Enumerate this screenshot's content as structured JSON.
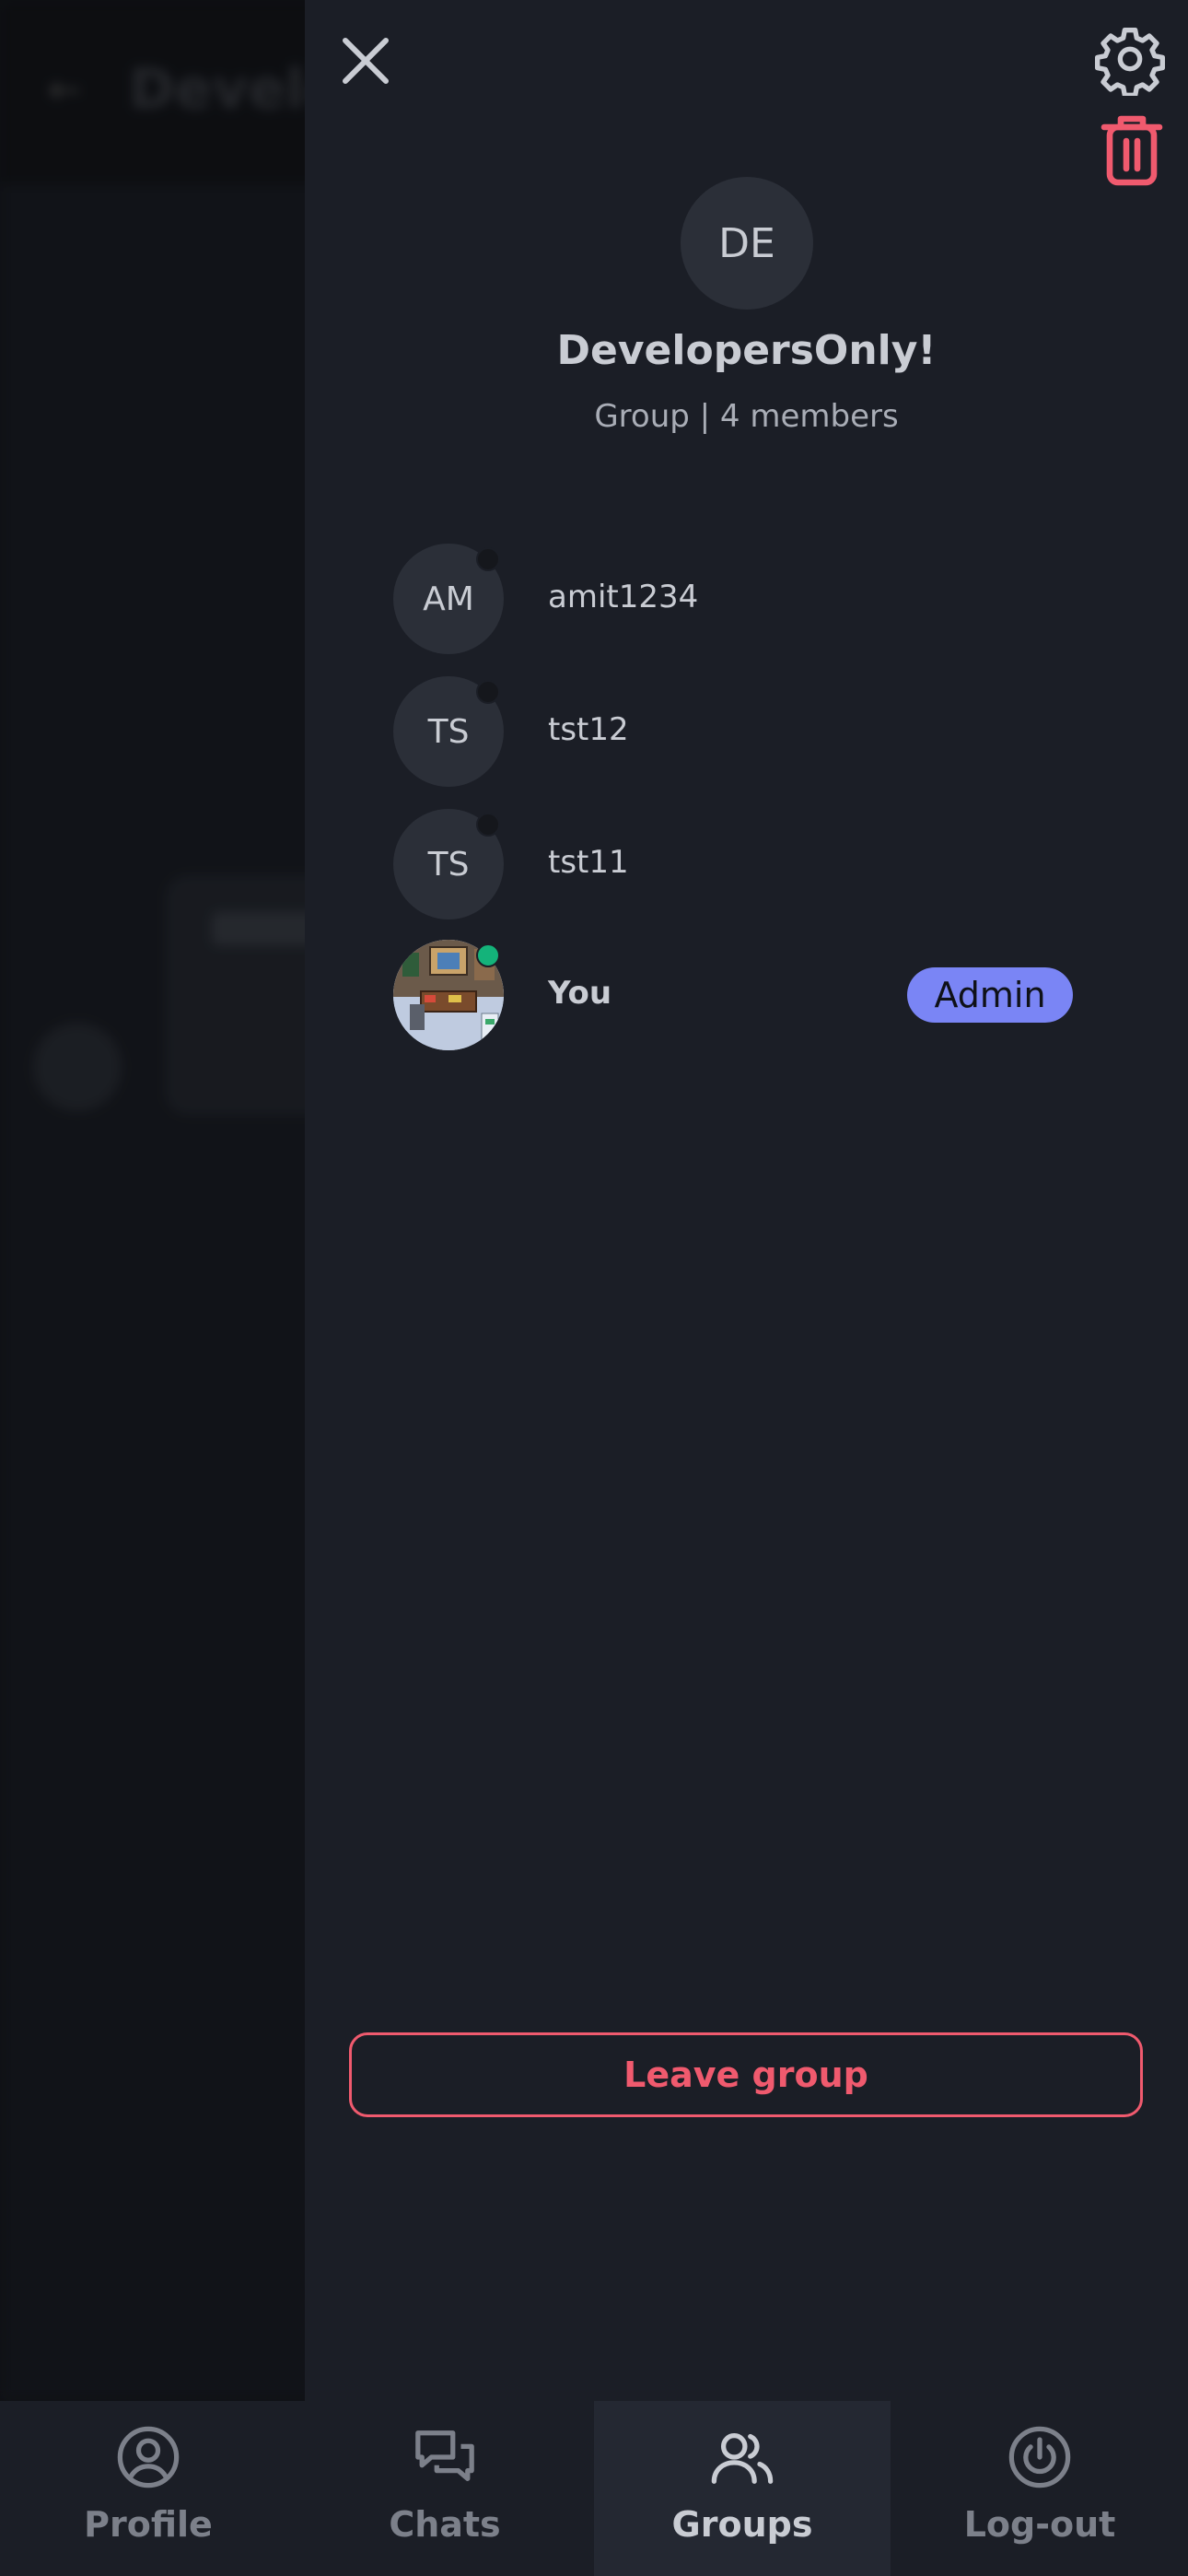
{
  "background": {
    "title": "Develo"
  },
  "drawer": {
    "group": {
      "initials": "DE",
      "name": "DevelopersOnly!",
      "subtitle": "Group | 4 members"
    },
    "members": [
      {
        "initials": "AM",
        "name": "amit1234",
        "status": "offline"
      },
      {
        "initials": "TS",
        "name": "tst12",
        "status": "offline"
      },
      {
        "initials": "TS",
        "name": "tst11",
        "status": "offline"
      },
      {
        "initials": "",
        "name": "You",
        "status": "online",
        "badge": "Admin"
      }
    ],
    "leave_label": "Leave group"
  },
  "nav": {
    "items": [
      {
        "label": "Profile",
        "icon": "user-circle-icon"
      },
      {
        "label": "Chats",
        "icon": "chat-bubbles-icon"
      },
      {
        "label": "Groups",
        "icon": "users-icon",
        "active": true
      },
      {
        "label": "Log-out",
        "icon": "power-icon"
      }
    ]
  },
  "colors": {
    "accent_admin": "#7a85f5",
    "danger": "#f05a6e",
    "online": "#14b37a",
    "panel": "#1b1e26"
  }
}
